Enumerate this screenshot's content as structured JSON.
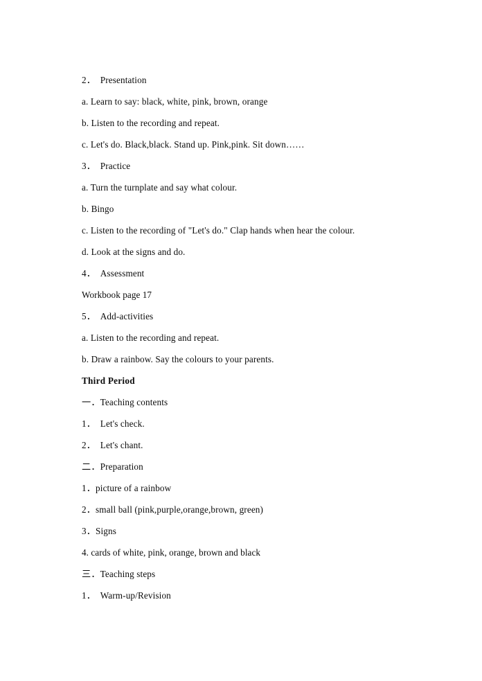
{
  "document": {
    "background_color": "#ffffff",
    "text_color": "#0b0b0b",
    "lines": [
      {
        "id": "l01",
        "text": "2．　Presentation",
        "style": "numbered"
      },
      {
        "id": "l02",
        "text": "a. Learn to say: black, white, pink, brown, orange",
        "style": "lettered"
      },
      {
        "id": "l03",
        "text": "b. Listen to the recording and repeat.",
        "style": "lettered"
      },
      {
        "id": "l04",
        "text": "c. Let's do. Black,black. Stand up. Pink,pink. Sit down……",
        "style": "lettered"
      },
      {
        "id": "l05",
        "text": "3．　Practice",
        "style": "numbered"
      },
      {
        "id": "l06",
        "text": "a. Turn the turnplate and say what colour.",
        "style": "lettered"
      },
      {
        "id": "l07",
        "text": "b. Bingo",
        "style": "lettered"
      },
      {
        "id": "l08",
        "text": "c. Listen to the recording of \"Let's do.\" Clap hands when hear the colour.",
        "style": "lettered"
      },
      {
        "id": "l09",
        "text": "d. Look at the signs and do.",
        "style": "lettered"
      },
      {
        "id": "l10",
        "text": "4．　Assessment",
        "style": "numbered"
      },
      {
        "id": "l11",
        "text": "Workbook page 17",
        "style": "plain"
      },
      {
        "id": "l12",
        "text": "5．　Add-activities",
        "style": "numbered"
      },
      {
        "id": "l13",
        "text": "a. Listen to the recording and repeat.",
        "style": "lettered"
      },
      {
        "id": "l14",
        "text": "b. Draw a rainbow. Say the colours to your parents.",
        "style": "lettered"
      },
      {
        "id": "l15",
        "text": "Third Period",
        "style": "heading-bold"
      },
      {
        "id": "l16",
        "text": "一．Teaching contents",
        "style": "cjk-section"
      },
      {
        "id": "l17",
        "text": "1．　Let's check.",
        "style": "numbered"
      },
      {
        "id": "l18",
        "text": "2．　Let's chant.",
        "style": "numbered"
      },
      {
        "id": "l19",
        "text": "二．Preparation",
        "style": "cjk-section"
      },
      {
        "id": "l20",
        "text": "1．picture of a rainbow",
        "style": "numbered-tight"
      },
      {
        "id": "l21",
        "text": "2．small ball (pink,purple,orange,brown, green)",
        "style": "numbered-tight"
      },
      {
        "id": "l22",
        "text": "3．Signs",
        "style": "numbered-tight"
      },
      {
        "id": "l23",
        "text": "4. cards of white, pink, orange, brown and black",
        "style": "plain"
      },
      {
        "id": "l24",
        "text": "三．Teaching steps",
        "style": "cjk-section"
      },
      {
        "id": "l25",
        "text": "1．　Warm-up/Revision",
        "style": "numbered"
      }
    ]
  }
}
